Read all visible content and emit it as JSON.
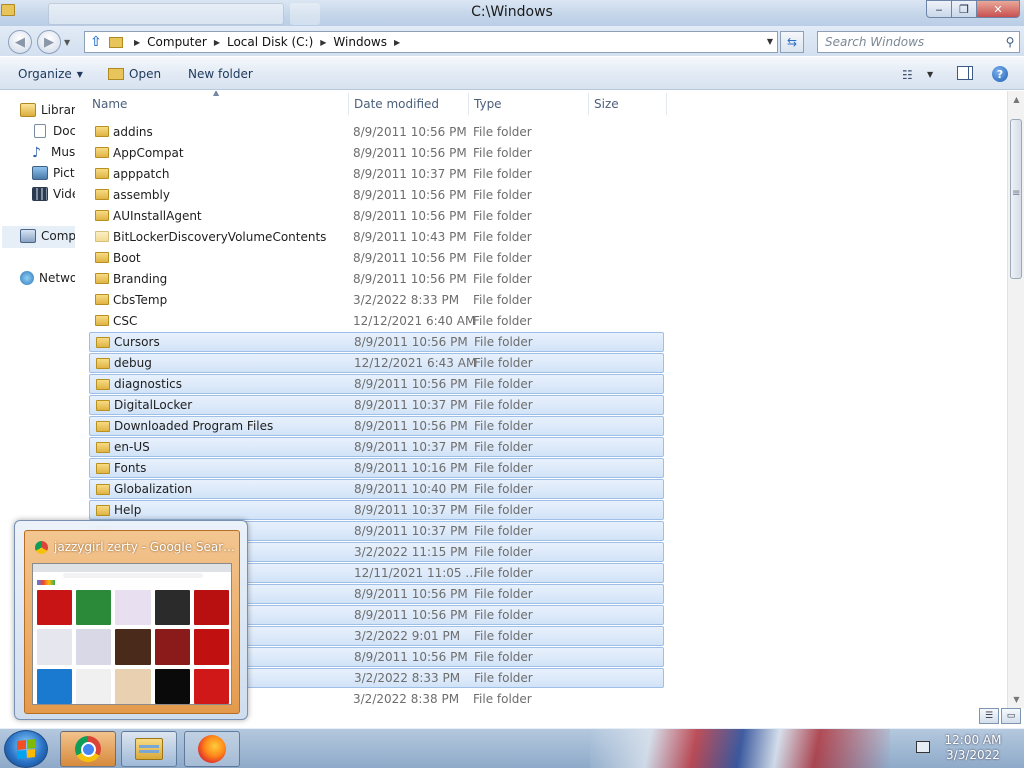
{
  "window": {
    "title": "C:\\Windows",
    "buttons": {
      "minimize": "‒",
      "maximize": "❐",
      "close": "✕"
    }
  },
  "address": {
    "crumbs": [
      "Computer",
      "Local Disk (C:)",
      "Windows"
    ],
    "search_placeholder": "Search Windows"
  },
  "commands": {
    "organize": "Organize",
    "open": "Open",
    "new_folder": "New folder"
  },
  "navpane": {
    "items": [
      {
        "label": "Libraries",
        "icon": "library-icon"
      },
      {
        "label": "Documents",
        "icon": "documents-icon"
      },
      {
        "label": "Music",
        "icon": "music-icon"
      },
      {
        "label": "Pictures",
        "icon": "pictures-icon"
      },
      {
        "label": "Videos",
        "icon": "videos-icon"
      },
      {
        "label": "Computer",
        "icon": "computer-icon"
      },
      {
        "label": "Network",
        "icon": "network-icon"
      }
    ]
  },
  "columns": {
    "name": "Name",
    "date": "Date modified",
    "type": "Type",
    "size": "Size"
  },
  "files": [
    {
      "name": "addins",
      "date": "8/9/2011 10:56 PM",
      "type": "File folder",
      "selected": false
    },
    {
      "name": "AppCompat",
      "date": "8/9/2011 10:56 PM",
      "type": "File folder",
      "selected": false
    },
    {
      "name": "apppatch",
      "date": "8/9/2011 10:37 PM",
      "type": "File folder",
      "selected": false
    },
    {
      "name": "assembly",
      "date": "8/9/2011 10:56 PM",
      "type": "File folder",
      "selected": false
    },
    {
      "name": "AUInstallAgent",
      "date": "8/9/2011 10:56 PM",
      "type": "File folder",
      "selected": false
    },
    {
      "name": "BitLockerDiscoveryVolumeContents",
      "date": "8/9/2011 10:43 PM",
      "type": "File folder",
      "selected": false
    },
    {
      "name": "Boot",
      "date": "8/9/2011 10:56 PM",
      "type": "File folder",
      "selected": false
    },
    {
      "name": "Branding",
      "date": "8/9/2011 10:56 PM",
      "type": "File folder",
      "selected": false
    },
    {
      "name": "CbsTemp",
      "date": "3/2/2022 8:33 PM",
      "type": "File folder",
      "selected": false
    },
    {
      "name": "CSC",
      "date": "12/12/2021 6:40 AM",
      "type": "File folder",
      "selected": false
    },
    {
      "name": "Cursors",
      "date": "8/9/2011 10:56 PM",
      "type": "File folder",
      "selected": true
    },
    {
      "name": "debug",
      "date": "12/12/2021 6:43 AM",
      "type": "File folder",
      "selected": true
    },
    {
      "name": "diagnostics",
      "date": "8/9/2011 10:56 PM",
      "type": "File folder",
      "selected": true
    },
    {
      "name": "DigitalLocker",
      "date": "8/9/2011 10:37 PM",
      "type": "File folder",
      "selected": true
    },
    {
      "name": "Downloaded Program Files",
      "date": "8/9/2011 10:56 PM",
      "type": "File folder",
      "selected": true
    },
    {
      "name": "en-US",
      "date": "8/9/2011 10:37 PM",
      "type": "File folder",
      "selected": true
    },
    {
      "name": "Fonts",
      "date": "8/9/2011 10:16 PM",
      "type": "File folder",
      "selected": true
    },
    {
      "name": "Globalization",
      "date": "8/9/2011 10:40 PM",
      "type": "File folder",
      "selected": true
    },
    {
      "name": "Help",
      "date": "8/9/2011 10:37 PM",
      "type": "File folder",
      "selected": true
    },
    {
      "name": "",
      "date": "8/9/2011 10:37 PM",
      "type": "File folder",
      "selected": true
    },
    {
      "name": "",
      "date": "3/2/2022 11:15 PM",
      "type": "File folder",
      "selected": true
    },
    {
      "name": "",
      "date": "12/11/2021 11:05 ...",
      "type": "File folder",
      "selected": true
    },
    {
      "name": "",
      "date": "8/9/2011 10:56 PM",
      "type": "File folder",
      "selected": true
    },
    {
      "name": "",
      "date": "8/9/2011 10:56 PM",
      "type": "File folder",
      "selected": true
    },
    {
      "name": "",
      "date": "3/2/2022 9:01 PM",
      "type": "File folder",
      "selected": true
    },
    {
      "name": "",
      "date": "8/9/2011 10:56 PM",
      "type": "File folder",
      "selected": true
    },
    {
      "name": "",
      "date": "3/2/2022 8:33 PM",
      "type": "File folder",
      "selected": true
    },
    {
      "name": "",
      "date": "3/2/2022 8:38 PM",
      "type": "File folder",
      "selected": false
    }
  ],
  "thumbnail": {
    "title": "jazzygirl zerty - Google Search - ...",
    "tile_colors": [
      "#c81414",
      "#2a8a3a",
      "#e8e0f0",
      "#2b2b2b",
      "#b81010",
      "#e6e6ee",
      "#d8d8e6",
      "#4a2a1a",
      "#8b1a1a",
      "#c01010",
      "#1a7ad0",
      "#f0f0f0",
      "#e8d0b0",
      "#0a0a0a",
      "#d01818"
    ]
  },
  "taskbar": {
    "time": "12:00 AM",
    "date": "3/3/2022"
  },
  "colors": {
    "selection": "#d2e3f8",
    "selection_border": "#9ec0e8",
    "folder": "#e0b444"
  }
}
